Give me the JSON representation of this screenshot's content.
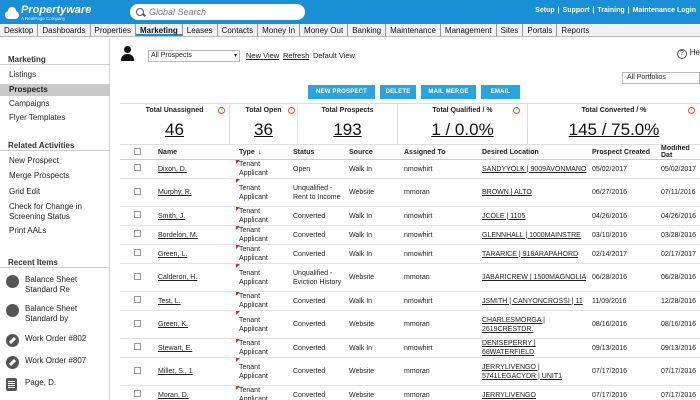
{
  "app": {
    "logo_name": "Propertyware",
    "logo_tag": "A RealPage Company",
    "search_placeholder": "Global Search",
    "top_links": [
      "Setup",
      "Support",
      "Training",
      "Maintenance Login"
    ]
  },
  "nav": {
    "tabs": [
      "Desktop",
      "Dashboards",
      "Properties",
      "Marketing",
      "Leases",
      "Contacts",
      "Money In",
      "Money Out",
      "Banking",
      "Maintenance",
      "Management",
      "Sites",
      "Portals",
      "Reports"
    ],
    "active": "Marketing"
  },
  "sidebar": {
    "marketing_title": "Marketing",
    "marketing_items": [
      "Listings",
      "Prospects",
      "Campaigns",
      "Flyer Templates"
    ],
    "active_item": "Prospects",
    "related_title": "Related Activities",
    "related_items": [
      "New Prospect",
      "Merge Prospects",
      "Grid Edit",
      "Check for Change in Screening Status",
      "Print AALs"
    ],
    "recent_title": "Recent Items",
    "recent_items": [
      {
        "icon": "report-icon",
        "label": "Balance Sheet Standard Re"
      },
      {
        "icon": "report-icon",
        "label": "Balance Sheet Standard by"
      },
      {
        "icon": "wrench-icon",
        "label": "Work Order #802"
      },
      {
        "icon": "wrench-icon",
        "label": "Work Order #807"
      },
      {
        "icon": "document-icon",
        "label": "Page, D."
      }
    ]
  },
  "toolbar": {
    "view_select": "All Prospects",
    "new_view": "New View",
    "refresh": "Refresh",
    "default_view": "Default View",
    "help_label": "He"
  },
  "portfolio_select": "All Portfolios",
  "actions": [
    "NEW PROSPECT",
    "DELETE",
    "MAIL MERGE",
    "EMAIL"
  ],
  "stats": [
    {
      "label": "Total Unassigned",
      "value": "46",
      "warn": true
    },
    {
      "label": "Total Open",
      "value": "36",
      "warn": true
    },
    {
      "label": "Total Prospects",
      "value": "193",
      "warn": false
    },
    {
      "label": "Total Qualified / %",
      "value": "1 / 0.0%",
      "warn": true
    },
    {
      "label": "Total Converted / %",
      "value": "145 / 75.0%",
      "warn": true
    }
  ],
  "table": {
    "columns": [
      "Name",
      "Type",
      "Status",
      "Source",
      "Assigned To",
      "Desired Location",
      "Prospect Created",
      "Modified Dat"
    ],
    "rows": [
      {
        "name": "Dixon, D.",
        "type": "Tenant Applicant",
        "status": "Open",
        "source": "Walk In",
        "assigned": "nmowhirt",
        "location": "SANDYYOLK | 9009AVONMANO",
        "created": "05/02/2017",
        "modified": "05/02/2017",
        "flag": true,
        "tall": false
      },
      {
        "name": "Murphy, R.",
        "type": "Tenant Applicant",
        "status": "Unqualified - Rent to Income",
        "source": "Website",
        "assigned": "mmoran",
        "location": "BROWN | ALTO",
        "created": "06/27/2016",
        "modified": "07/11/2016",
        "flag": true,
        "tall": true
      },
      {
        "name": "Smith, J.",
        "type": "Tenant Applicant",
        "status": "Converted",
        "source": "Walk In",
        "assigned": "nmowhirt",
        "location": "JCOLE | 1105",
        "created": "04/26/2016",
        "modified": "04/26/2016",
        "flag": true,
        "tall": false
      },
      {
        "name": "Bordelon, M.",
        "type": "Tenant Applicant",
        "status": "Converted",
        "source": "Walk In",
        "assigned": "nmowhirt",
        "location": "GLENNHALL | 1000MAINSTRE",
        "created": "03/10/2016",
        "modified": "03/28/2016",
        "flag": true,
        "tall": false
      },
      {
        "name": "Green, L.",
        "type": "Tenant Applicant",
        "status": "Converted",
        "source": "Walk In",
        "assigned": "nmowhirt",
        "location": "TARARICE | 918ARAPAHORD",
        "created": "02/14/2017",
        "modified": "02/17/2017",
        "flag": true,
        "tall": false
      },
      {
        "name": "Calderon, H.",
        "type": "Tenant Applicant",
        "status": "Unqualified - Eviction History",
        "source": "Website",
        "assigned": "mmoran",
        "location": "JABARICREW | 1500MAGNOLIA",
        "created": "06/28/2016",
        "modified": "06/28/2016",
        "flag": true,
        "tall": true
      },
      {
        "name": "Test, L.",
        "type": "Tenant Applicant",
        "status": "Converted",
        "source": "Walk In",
        "assigned": "nmowhirt",
        "location": "JSMITH | CANYONCROSSI | 11",
        "created": "11/09/2016",
        "modified": "12/28/2016",
        "flag": true,
        "tall": false
      },
      {
        "name": "Green, K.",
        "type": "Tenant Applicant",
        "status": "Converted",
        "source": "Website",
        "assigned": "mmoran",
        "location": "CHARLESMORGA | 2619CRESTDR.",
        "created": "08/16/2016",
        "modified": "08/16/2016",
        "flag": true,
        "tall": true
      },
      {
        "name": "Stewart, E.",
        "type": "Tenant Applicant",
        "status": "Converted",
        "source": "Walk In",
        "assigned": "nmowhirt",
        "location": "DENISEPERRY | 68WATERFIELD",
        "created": "09/13/2016",
        "modified": "09/13/2016",
        "flag": true,
        "tall": false
      },
      {
        "name": "Miller, S., 1",
        "type": "Tenant Applicant",
        "status": "Converted",
        "source": "Website",
        "assigned": "mmoran",
        "location": "JERRYLIVENGO | 5741LEGACYDR | UNIT1",
        "created": "07/17/2016",
        "modified": "07/17/2016",
        "flag": true,
        "tall": true
      },
      {
        "name": "Moran, D.",
        "type": "Tenant Applicant",
        "status": "Converted",
        "source": "Website",
        "assigned": "mmoran",
        "location": "JERRYLIVENGO",
        "created": "07/17/2016",
        "modified": "07/17/2016",
        "flag": true,
        "tall": false
      }
    ]
  },
  "colors": {
    "brand_blue": "#1a8fd6",
    "button_blue": "#2ba3e0",
    "warn_red": "#e05030"
  }
}
